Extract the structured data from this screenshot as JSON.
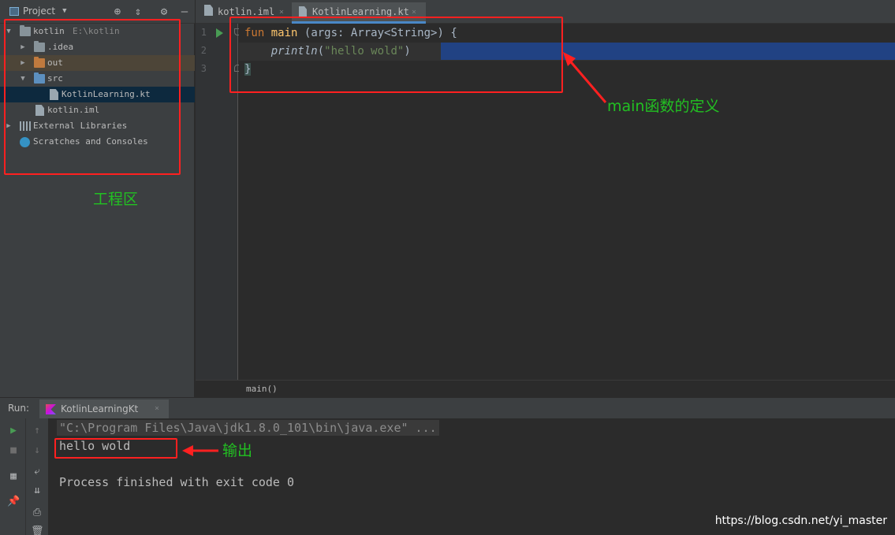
{
  "project": {
    "title": "Project",
    "tree": [
      {
        "name": "kotlin",
        "path": "E:\\kotlin"
      },
      {
        "name": ".idea"
      },
      {
        "name": "out"
      },
      {
        "name": "src"
      },
      {
        "name": "KotlinLearning.kt"
      },
      {
        "name": "kotlin.iml"
      },
      {
        "name": "External Libraries"
      },
      {
        "name": "Scratches and Consoles"
      }
    ]
  },
  "editor": {
    "tabs": [
      {
        "label": "kotlin.iml",
        "close": "×"
      },
      {
        "label": "KotlinLearning.kt",
        "close": "×"
      }
    ],
    "line_numbers": [
      "1",
      "2",
      "3"
    ],
    "code": {
      "l1_kw": "fun",
      "l1_fn": "main",
      "l1_rest": "(args: Array<String>) {",
      "l2_call": "println",
      "l2_open": "(",
      "l2_str": "\"hello wold\"",
      "l2_close": ")",
      "l3": "}"
    },
    "breadcrumb": "main()"
  },
  "run": {
    "label": "Run:",
    "tab_label": "KotlinLearningKt",
    "tab_close": "×",
    "console": {
      "command": "\"C:\\Program Files\\Java\\jdk1.8.0_101\\bin\\java.exe\" ...",
      "output": "hello wold",
      "exit_line": "Process finished with exit code 0"
    }
  },
  "annotations": {
    "project_area": "工程区",
    "main_def": "main函数的定义",
    "output": "输出",
    "watermark": "https://blog.csdn.net/yi_master"
  },
  "colors": {
    "annotation_box": "#ff2020",
    "annotation_text": "#22c022"
  }
}
